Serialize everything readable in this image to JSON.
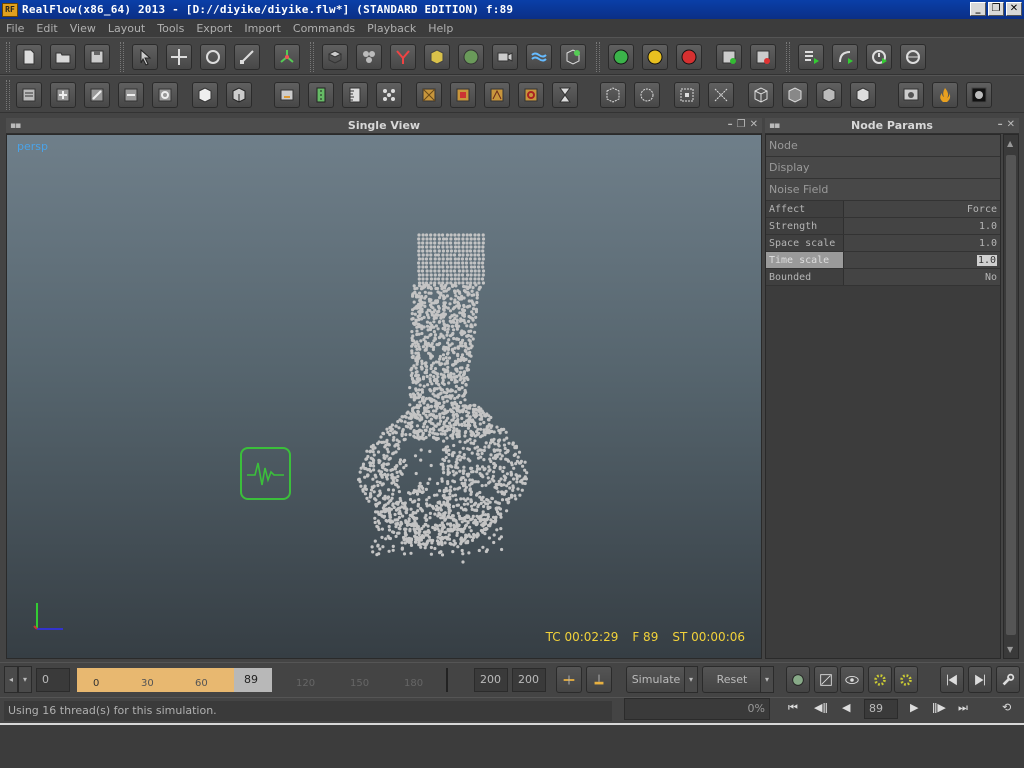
{
  "window": {
    "title": "RealFlow(x86_64) 2013 - [D://diyike/diyike.flw*] (STANDARD EDITION) f:89",
    "app_icon_text": "RF",
    "controls": [
      "_",
      "❐",
      "✕"
    ]
  },
  "menu": [
    "File",
    "Edit",
    "View",
    "Layout",
    "Tools",
    "Export",
    "Import",
    "Commands",
    "Playback",
    "Help"
  ],
  "viewport": {
    "title": "Single View",
    "camera": "persp",
    "hud": {
      "tc": "TC 00:02:29",
      "frame": "F 89",
      "st": "ST 00:00:06"
    }
  },
  "params": {
    "title": "Node Params",
    "sections": [
      "Node",
      "Display",
      "Noise Field"
    ],
    "rows": [
      {
        "name": "Affect",
        "value": "Force"
      },
      {
        "name": "Strength",
        "value": "1.0"
      },
      {
        "name": "Space scale",
        "value": "1.0"
      },
      {
        "name": "Time scale",
        "value": "1.0"
      },
      {
        "name": "Bounded",
        "value": "No"
      }
    ]
  },
  "timeline": {
    "start": "0",
    "ticks_in_range": [
      "0",
      "30",
      "60"
    ],
    "current": "89",
    "ticks_after": [
      "120",
      "150",
      "180"
    ],
    "end1": "200",
    "end2": "200",
    "simulate_label": "Simulate",
    "reset_label": "Reset"
  },
  "status": {
    "message": "Using 16 thread(s) for this simulation.",
    "progress": "0%",
    "frame": "89"
  },
  "colors": {
    "accent_hud": "#f2d23a",
    "persp_label": "#4aa3e8",
    "timeline_range": "#e8b870",
    "daemon_icon": "#3bbf3b"
  }
}
